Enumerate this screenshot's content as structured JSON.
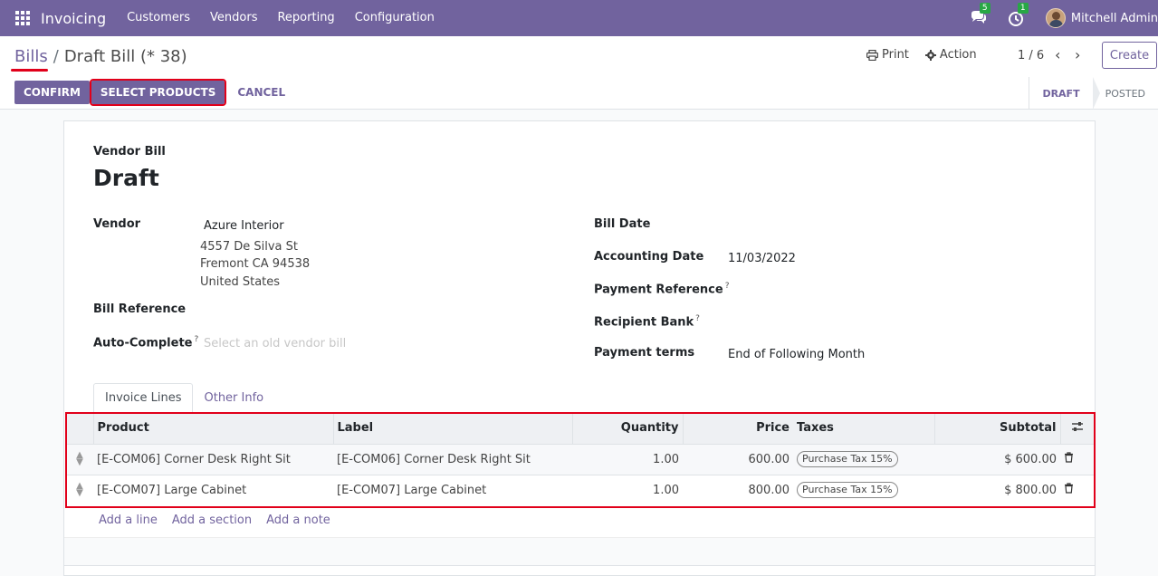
{
  "navbar": {
    "brand": "Invoicing",
    "menu": [
      "Customers",
      "Vendors",
      "Reporting",
      "Configuration"
    ],
    "messages_count": "5",
    "activities_count": "1",
    "user_name": "Mitchell Admin"
  },
  "breadcrumb": {
    "parent": "Bills",
    "separator": "/",
    "current": "Draft Bill (* 38)"
  },
  "control": {
    "print_label": "Print",
    "action_label": "Action",
    "pager": "1 / 6",
    "create_label": "Create"
  },
  "statusbar": {
    "confirm_label": "CONFIRM",
    "select_products_label": "SELECT PRODUCTS",
    "cancel_label": "CANCEL",
    "stages": [
      "DRAFT",
      "POSTED"
    ]
  },
  "form": {
    "kind": "Vendor Bill",
    "title": "Draft",
    "vendor_label": "Vendor",
    "vendor_name": "Azure Interior",
    "vendor_address": [
      "4557 De Silva St",
      "Fremont CA 94538",
      "United States"
    ],
    "bill_reference_label": "Bill Reference",
    "auto_complete_label": "Auto-Complete",
    "auto_complete_placeholder": "Select an old vendor bill",
    "bill_date_label": "Bill Date",
    "accounting_date_label": "Accounting Date",
    "accounting_date_value": "11/03/2022",
    "payment_reference_label": "Payment Reference",
    "recipient_bank_label": "Recipient Bank",
    "payment_terms_label": "Payment terms",
    "payment_terms_value": "End of Following Month",
    "help_mark": "?"
  },
  "tabs": [
    "Invoice Lines",
    "Other Info"
  ],
  "lines": {
    "columns": {
      "product": "Product",
      "label": "Label",
      "quantity": "Quantity",
      "price": "Price",
      "taxes": "Taxes",
      "subtotal": "Subtotal"
    },
    "rows": [
      {
        "product": "[E-COM06] Corner Desk Right Sit",
        "label": "[E-COM06] Corner Desk Right Sit",
        "quantity": "1.00",
        "price": "600.00",
        "tax": "Purchase Tax 15%",
        "subtotal": "$ 600.00"
      },
      {
        "product": "[E-COM07] Large Cabinet",
        "label": "[E-COM07] Large Cabinet",
        "quantity": "1.00",
        "price": "800.00",
        "tax": "Purchase Tax 15%",
        "subtotal": "$ 800.00"
      }
    ],
    "add_line": "Add a line",
    "add_section": "Add a section",
    "add_note": "Add a note"
  },
  "icons": {
    "apps": "apps-grid-icon",
    "messages": "chat-icon",
    "activities": "clock-icon",
    "print": "printer-icon",
    "action": "gear-icon",
    "prev": "chevron-left-icon",
    "next": "chevron-right-icon",
    "handle": "drag-handle-icon",
    "delete": "trash-icon",
    "optional_columns": "sliders-icon"
  },
  "colors": {
    "brand": "#71639e",
    "highlight": "#e1001a",
    "badge": "#28a745"
  }
}
